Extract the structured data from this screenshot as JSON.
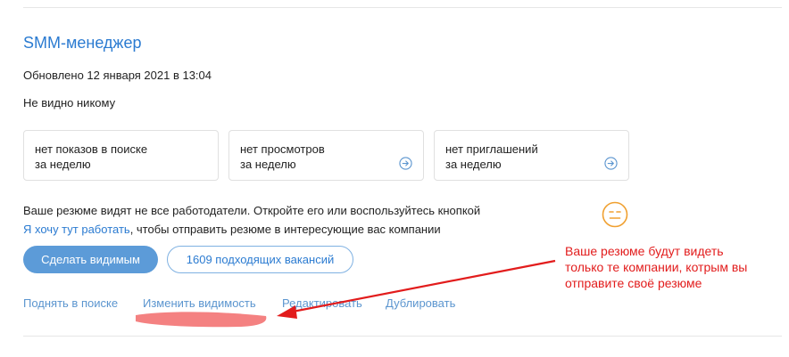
{
  "resume": {
    "title": "SMM-менеджер",
    "updated": "Обновлено 12 января 2021 в 13:04",
    "visibility": "Не видно никому"
  },
  "stats": [
    {
      "line1": "нет показов в поиске",
      "line2": "за неделю"
    },
    {
      "line1": "нет просмотров",
      "line2": "за неделю",
      "icon": "arrow-right-circle-icon"
    },
    {
      "line1": "нет приглашений",
      "line2": "за неделю",
      "icon": "arrow-right-circle-icon"
    }
  ],
  "notice": {
    "text1": "Ваше резюме видят не все работодатели. Откройте его или воспользуйтесь кнопкой",
    "link": "Я хочу тут работать",
    "text2": ", чтобы отправить резюме в интересующие вас компании",
    "icon": "neutral-face-icon"
  },
  "buttons": {
    "make_visible": "Сделать видимым",
    "vacancies": "1609 подходящих вакансий"
  },
  "actions": {
    "raise": "Поднять в поиске",
    "change_visibility": "Изменить видимость",
    "edit": "Редактировать",
    "duplicate": "Дублировать"
  },
  "annotation": {
    "line1": "Ваше резюме будут видеть",
    "line2": "только те компании, котрым вы",
    "line3": "отправите своё резюме"
  },
  "colors": {
    "link": "#2b7bd1",
    "button": "#5c9bd8",
    "annotation": "#e21c1c",
    "emoji": "#f0a030"
  }
}
